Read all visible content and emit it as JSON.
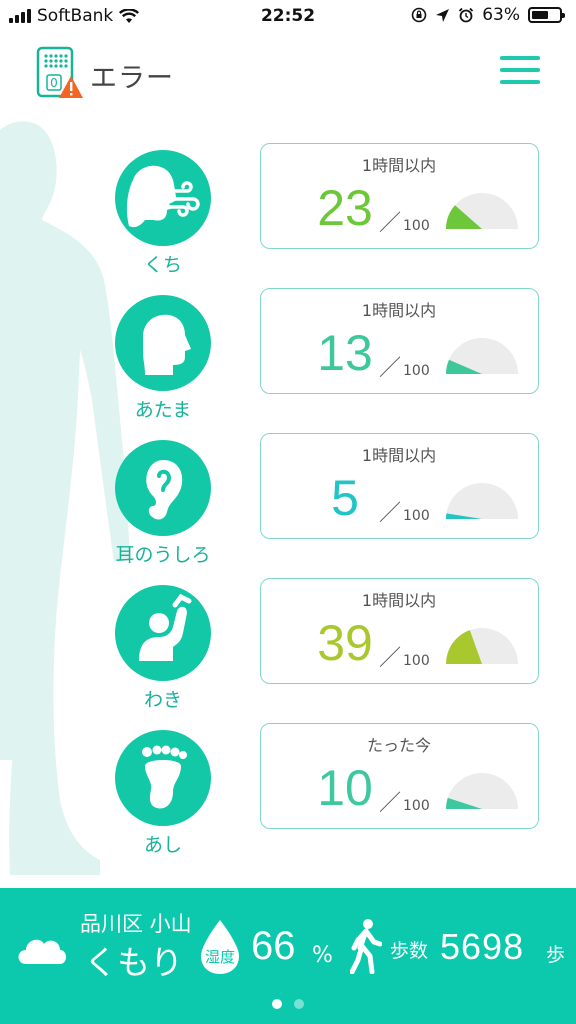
{
  "status_bar": {
    "carrier": "SoftBank",
    "time": "22:52",
    "battery_percent": "63%",
    "battery_level": 0.63
  },
  "header": {
    "title": "エラー",
    "device_icon_digit": "0"
  },
  "rows": [
    {
      "label": "くち",
      "time": "1時間以内",
      "score": "23",
      "max": "100",
      "level": 23,
      "color": "#6cc83a",
      "icon": "mouth-breath-icon"
    },
    {
      "label": "あたま",
      "time": "1時間以内",
      "score": "13",
      "max": "100",
      "level": 13,
      "color": "#3ec89a",
      "icon": "head-icon"
    },
    {
      "label": "耳のうしろ",
      "time": "1時間以内",
      "score": "5",
      "max": "100",
      "level": 5,
      "color": "#22c4c4",
      "icon": "ear-icon"
    },
    {
      "label": "わき",
      "time": "1時間以内",
      "score": "39",
      "max": "100",
      "level": 39,
      "color": "#a8c82e",
      "icon": "armpit-icon"
    },
    {
      "label": "あし",
      "time": "たった今",
      "score": "10",
      "max": "100",
      "level": 10,
      "color": "#3ec8a0",
      "icon": "foot-icon"
    }
  ],
  "bottom": {
    "location": "品川区 小山",
    "condition": "くもり",
    "humidity_label": "湿度",
    "humidity_value": "66",
    "humidity_unit": "%",
    "steps_label": "歩数",
    "steps_value": "5698",
    "steps_unit": "歩",
    "page_count": 2,
    "current_page": 1
  },
  "colors": {
    "accent": "#13c8a6",
    "bottom_bar": "#0cc9ad",
    "gauge_track": "#ececec",
    "warning": "#f26522"
  }
}
